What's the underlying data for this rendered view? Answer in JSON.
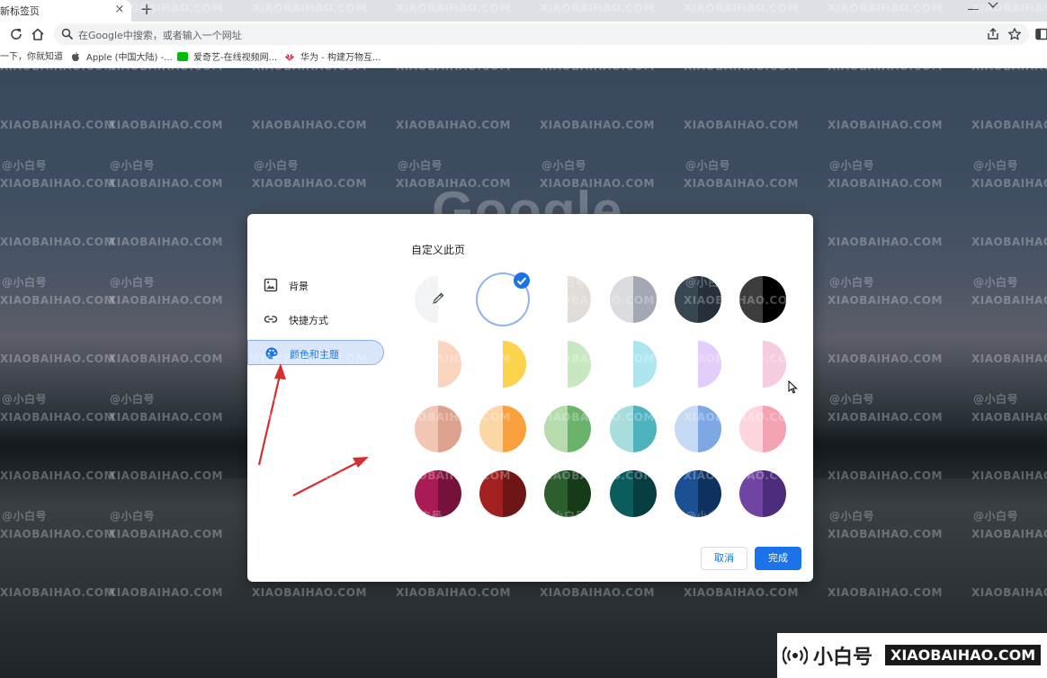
{
  "browser": {
    "tab_title": "新标签页",
    "tab_close": "×",
    "new_tab": "+",
    "omnibox_placeholder": "在Google中搜索，或者输入一个网址",
    "bookmarks": [
      {
        "label": "一下，你就知道",
        "icon": "baidu-icon",
        "color": "#2932e1"
      },
      {
        "label": "Apple (中国大陆) -...",
        "icon": "apple-icon",
        "color": "#555555"
      },
      {
        "label": "爱奇艺-在线视频网...",
        "icon": "iqiyi-icon",
        "color": "#00be06"
      },
      {
        "label": "华为 - 构建万物互...",
        "icon": "huawei-icon",
        "color": "#cf0a2c"
      }
    ]
  },
  "page": {
    "logo_text": "Google"
  },
  "dialog": {
    "title": "自定义此页",
    "menu": [
      {
        "label": "背景",
        "icon": "image-icon"
      },
      {
        "label": "快捷方式",
        "icon": "link-icon"
      },
      {
        "label": "颜色和主题",
        "icon": "palette-icon",
        "active": true
      }
    ],
    "selected_swatch": 1,
    "swatches": [
      {
        "name": "custom-color-picker",
        "left": "#f1f3f4",
        "right": "#ffffff",
        "custom": true
      },
      {
        "name": "default-white",
        "left": "#ffffff",
        "right": "#ffffff"
      },
      {
        "name": "warm-grey",
        "left": "#ffffff",
        "right": "#e2dcd8"
      },
      {
        "name": "cool-grey",
        "left": "#dadce0",
        "right": "#a3a8b4"
      },
      {
        "name": "slate",
        "left": "#384651",
        "right": "#25303a"
      },
      {
        "name": "black",
        "left": "#3c3c3c",
        "right": "#000000"
      },
      {
        "name": "peach-light",
        "left": "#ffffff",
        "right": "#fbd4bd"
      },
      {
        "name": "yellow",
        "left": "#ffffff",
        "right": "#fcd34d"
      },
      {
        "name": "green-light",
        "left": "#ffffff",
        "right": "#c7e8c0"
      },
      {
        "name": "cyan-light",
        "left": "#ffffff",
        "right": "#aee6f0"
      },
      {
        "name": "lavender-light",
        "left": "#ffffff",
        "right": "#e3cdfa"
      },
      {
        "name": "pink-light",
        "left": "#ffffff",
        "right": "#f6cde0"
      },
      {
        "name": "salmon",
        "left": "#f2c6b5",
        "right": "#dca28d"
      },
      {
        "name": "orange",
        "left": "#fdd6a6",
        "right": "#f9a23d"
      },
      {
        "name": "green",
        "left": "#b6dcae",
        "right": "#6bb36b"
      },
      {
        "name": "teal",
        "left": "#a9dcdc",
        "right": "#4fb3bf"
      },
      {
        "name": "blue-light",
        "left": "#c6daf6",
        "right": "#7ea8e4"
      },
      {
        "name": "pink",
        "left": "#fcd6dc",
        "right": "#f4a3b3"
      },
      {
        "name": "magenta",
        "left": "#a81b54",
        "right": "#76123b"
      },
      {
        "name": "red",
        "left": "#a32020",
        "right": "#6e1616"
      },
      {
        "name": "forest",
        "left": "#2c5e2e",
        "right": "#163b19"
      },
      {
        "name": "dark-teal",
        "left": "#0b5c5c",
        "right": "#063d40"
      },
      {
        "name": "navy",
        "left": "#1a4f94",
        "right": "#0d325f"
      },
      {
        "name": "purple",
        "left": "#7044a3",
        "right": "#4d2c7b"
      }
    ],
    "cancel_label": "取消",
    "done_label": "完成"
  },
  "watermark": {
    "text": "XIAOBAIHAO.COM",
    "handle": "@小白号",
    "badge_cn": "小白号",
    "badge_en": "XIAOBAIHAO.COM"
  },
  "colors": {
    "accent": "#1a73e8",
    "annotation_arrow": "#d32f2f"
  }
}
